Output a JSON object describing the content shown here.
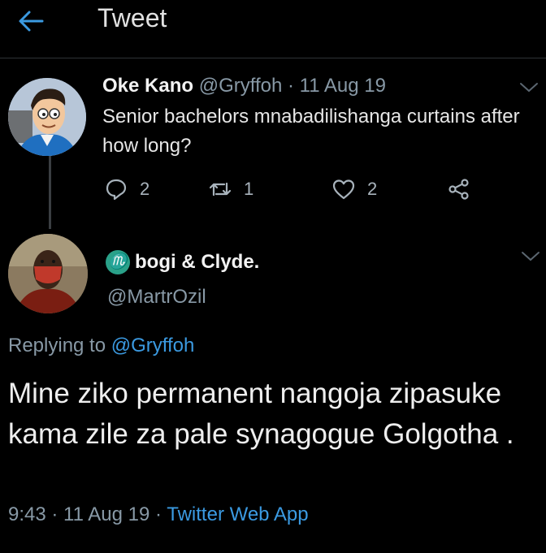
{
  "header": {
    "title": "Tweet",
    "back_icon": "arrow-left-icon"
  },
  "colors": {
    "background": "#000000",
    "accent": "#3b9ae1",
    "muted": "#8899a6"
  },
  "original_tweet": {
    "display_name": "Oke Kano",
    "meta": "@Gryffoh · 11 Aug 19",
    "text": "Senior bachelors mnabadilishanga curtains after how long?",
    "actions": {
      "reply_count": "2",
      "retweet_count": "1",
      "like_count": "2"
    }
  },
  "reply_tweet": {
    "display_name_emoji": "♏",
    "display_name": "bogi & Clyde.",
    "handle": "@MartrOzil",
    "replying_prefix": "Replying to",
    "replying_to": "@Gryffoh",
    "text": "Mine ziko permanent nangoja zipasuke kama zile za pale synagogue Golgotha .",
    "timestamp": "9:43 · 11 Aug 19 ·",
    "source": "Twitter Web App"
  }
}
